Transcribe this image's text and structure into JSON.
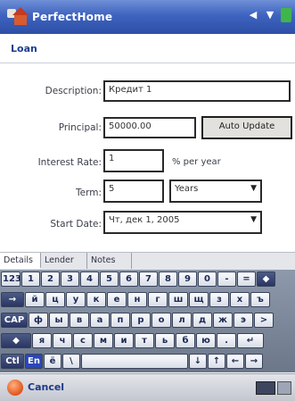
{
  "titlebar": {
    "app_title": "PerfectHome"
  },
  "section": {
    "title": "Loan"
  },
  "form": {
    "description_label": "Description:",
    "description_value": "Кредит 1",
    "principal_label": "Principal:",
    "principal_value": "50000.00",
    "auto_update_label": "Auto Update",
    "interest_label": "Interest Rate:",
    "interest_value": "1",
    "interest_unit": "% per year",
    "term_label": "Term:",
    "term_value": "5",
    "term_unit_value": "Years",
    "start_label": "Start Date:",
    "start_value": "Чт, дек 1, 2005"
  },
  "tabs": {
    "details": "Details",
    "lender": "Lender",
    "notes": "Notes"
  },
  "keyboard": {
    "row1": [
      "123",
      "1",
      "2",
      "3",
      "4",
      "5",
      "6",
      "7",
      "8",
      "9",
      "0",
      "-",
      "=",
      "◆"
    ],
    "row2": [
      "→",
      "й",
      "ц",
      "у",
      "к",
      "е",
      "н",
      "г",
      "ш",
      "щ",
      "з",
      "х",
      "ъ"
    ],
    "row3": [
      "CAP",
      "ф",
      "ы",
      "в",
      "а",
      "п",
      "р",
      "о",
      "л",
      "д",
      "ж",
      "э",
      ">"
    ],
    "row4": [
      "◆",
      "я",
      "ч",
      "с",
      "м",
      "и",
      "т",
      "ь",
      "б",
      "ю",
      ".",
      "↵"
    ],
    "row5": [
      "Ctl",
      "En",
      "ё",
      "\\",
      "",
      "↓",
      "↑",
      "←",
      "→"
    ]
  },
  "bottombar": {
    "cancel_label": "Cancel"
  }
}
